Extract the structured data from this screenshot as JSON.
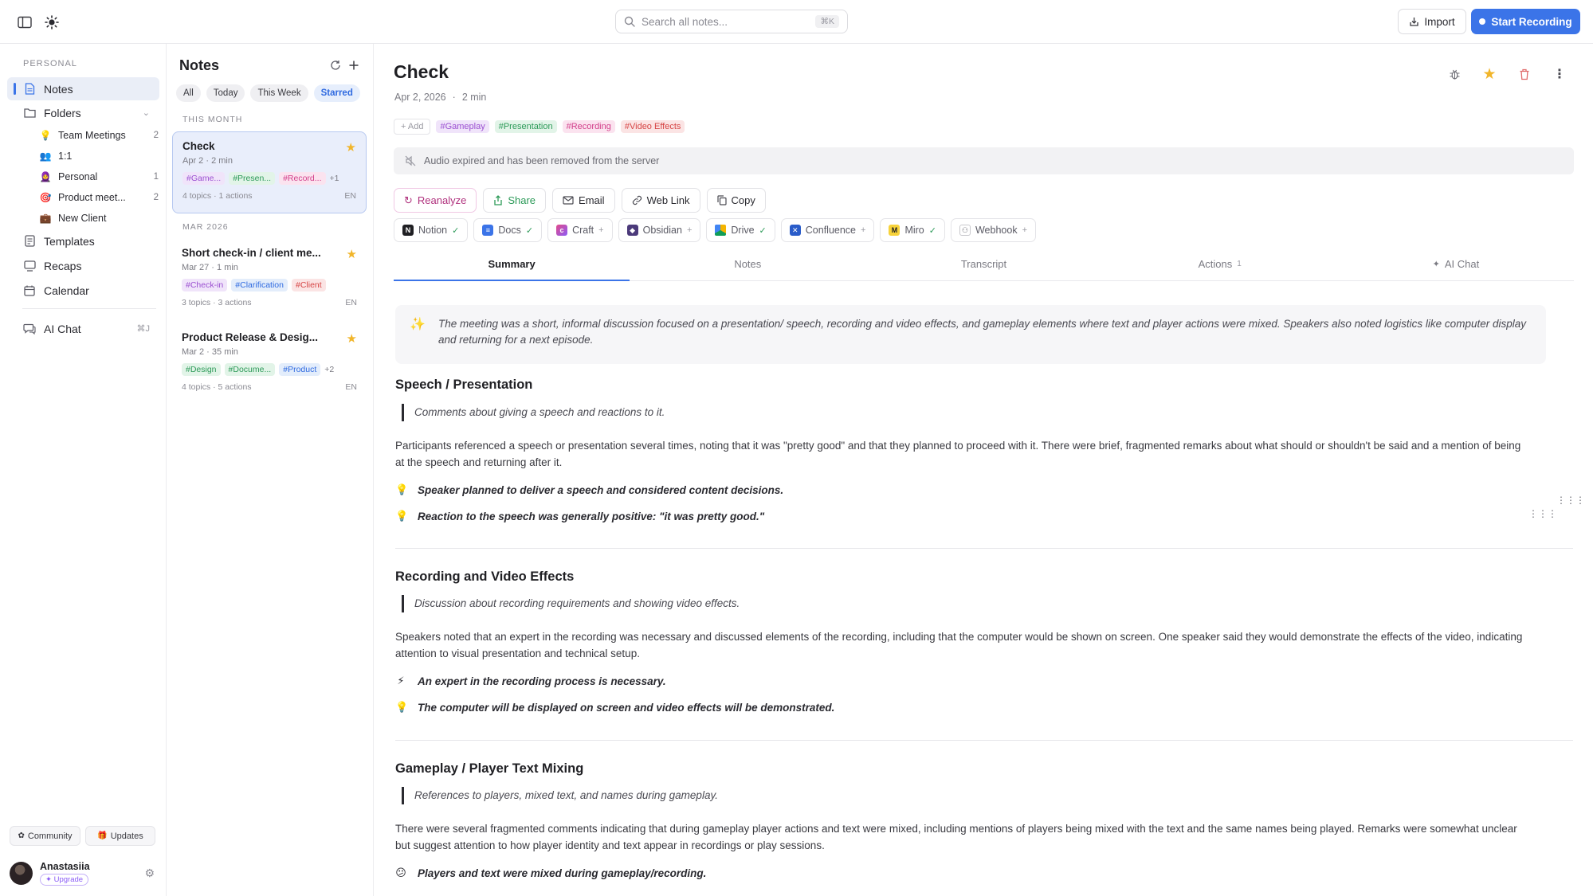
{
  "topbar": {
    "search_placeholder": "Search all notes...",
    "search_shortcut": "⌘K",
    "import_label": "Import",
    "record_label": "Start Recording"
  },
  "sidebar": {
    "section": "PERSONAL",
    "notes": "Notes",
    "folders": "Folders",
    "subfolders": [
      {
        "emoji": "💡",
        "label": "Team Meetings",
        "count": "2"
      },
      {
        "emoji": "👥",
        "label": "1:1",
        "count": ""
      },
      {
        "emoji": "🧕",
        "label": "Personal",
        "count": "1"
      },
      {
        "emoji": "🎯",
        "label": "Product meet...",
        "count": "2"
      },
      {
        "emoji": "💼",
        "label": "New Client",
        "count": ""
      }
    ],
    "templates": "Templates",
    "recaps": "Recaps",
    "calendar": "Calendar",
    "ai_chat": "AI Chat",
    "ai_chat_shortcut": "⌘J",
    "community": "Community",
    "updates": "Updates",
    "user_name": "Anastasiia",
    "upgrade": "Upgrade"
  },
  "notes_list": {
    "title": "Notes",
    "filters": [
      "All",
      "Today",
      "This Week",
      "Starred"
    ],
    "group_this_month": "THIS MONTH",
    "group_mar": "MAR 2026",
    "cards": [
      {
        "title": "Check",
        "date": "Apr 2",
        "duration": "2 min",
        "tags": [
          "#Game...",
          "#Presen...",
          "#Record..."
        ],
        "more": "+1",
        "topics": "4 topics",
        "actions": "1 actions",
        "lang": "EN"
      },
      {
        "title": "Short check-in / client me...",
        "date": "Mar 27",
        "duration": "1 min",
        "tags": [
          "#Check-in",
          "#Clarification",
          "#Client"
        ],
        "more": "",
        "topics": "3 topics",
        "actions": "3 actions",
        "lang": "EN"
      },
      {
        "title": "Product Release & Desig...",
        "date": "Mar 2",
        "duration": "35 min",
        "tags": [
          "#Design",
          "#Docume...",
          "#Product"
        ],
        "more": "+2",
        "topics": "4 topics",
        "actions": "5 actions",
        "lang": "EN"
      }
    ]
  },
  "note": {
    "title": "Check",
    "date": "Apr 2, 2026",
    "duration": "2 min",
    "add_tag": "+ Add",
    "tags": [
      "#Gameplay",
      "#Presentation",
      "#Recording",
      "#Video Effects"
    ],
    "notice": "Audio expired and has been removed from the server",
    "actions": [
      "Reanalyze",
      "Share",
      "Email",
      "Web Link",
      "Copy"
    ],
    "integrations": [
      {
        "name": "Notion",
        "status": "✓"
      },
      {
        "name": "Docs",
        "status": "✓"
      },
      {
        "name": "Craft",
        "status": "+"
      },
      {
        "name": "Obsidian",
        "status": "+"
      },
      {
        "name": "Drive",
        "status": "✓"
      },
      {
        "name": "Confluence",
        "status": "+"
      },
      {
        "name": "Miro",
        "status": "✓"
      },
      {
        "name": "Webhook",
        "status": "+"
      }
    ],
    "tabs": [
      "Summary",
      "Notes",
      "Transcript",
      "Actions",
      "AI Chat"
    ],
    "actions_count": "1",
    "summary": "The meeting was a short, informal discussion focused on a presentation/ speech, recording and video effects, and gameplay elements where text and player actions were mixed. Speakers also noted logistics like computer display and returning for a next episode.",
    "sections": [
      {
        "title": "Speech / Presentation",
        "quote": "Comments about giving a speech and reactions to it.",
        "para": "Participants referenced a speech or presentation several times, noting that it was \"pretty good\" and that they planned to proceed with it. There were brief, fragmented remarks about what should or shouldn't be said and a mention of being at the speech and returning after it.",
        "points": [
          "Speaker planned to deliver a speech and considered content decisions.",
          "Reaction to the speech was generally positive: \"it was pretty good.\""
        ]
      },
      {
        "title": "Recording and Video Effects",
        "quote": "Discussion about recording requirements and showing video effects.",
        "para": "Speakers noted that an expert in the recording was necessary and discussed elements of the recording, including that the computer would be shown on screen. One speaker said they would demonstrate the effects of the video, indicating attention to visual presentation and technical setup.",
        "points": [
          "An expert in the recording process is necessary.",
          "The computer will be displayed on screen and video effects will be demonstrated."
        ]
      },
      {
        "title": "Gameplay / Player Text Mixing",
        "quote": "References to players, mixed text, and names during gameplay.",
        "para": "There were several fragmented comments indicating that during gameplay player actions and text were mixed, including mentions of players being mixed with the text and the same names being played. Remarks were somewhat unclear but suggest attention to how player identity and text appear in recordings or play sessions.",
        "points": [
          "Players and text were mixed during gameplay/recording."
        ]
      }
    ]
  },
  "colors": {
    "accent": "#3b74e8",
    "star": "#f1b52a",
    "tag_gameplay": "#9b4fd1",
    "tag_presentation": "#2c9a58",
    "tag_recording": "#d23f8a",
    "tag_video": "#d64545"
  }
}
